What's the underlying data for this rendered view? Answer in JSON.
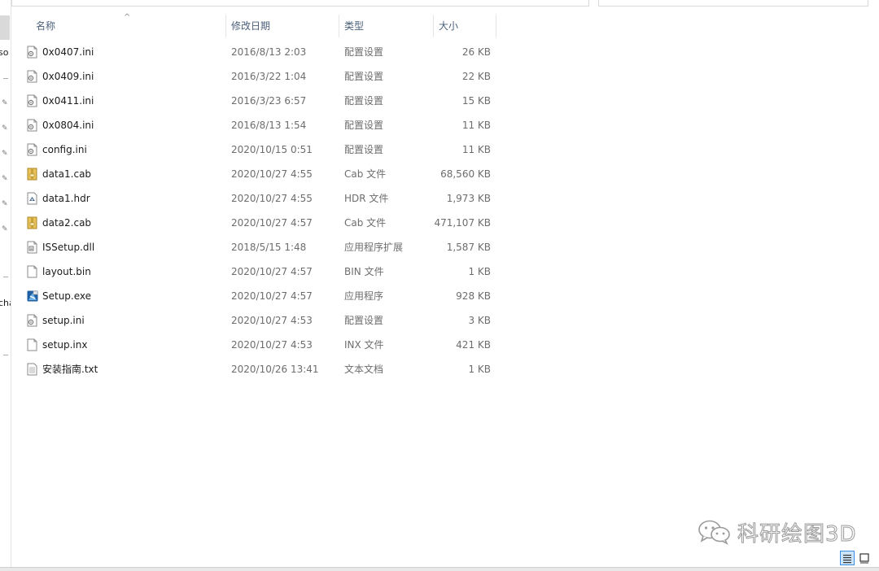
{
  "nav": {
    "fragments": [
      "so",
      "cha"
    ]
  },
  "columns": {
    "name": "名称",
    "date": "修改日期",
    "type": "类型",
    "size": "大小"
  },
  "files": [
    {
      "name": "0x0407.ini",
      "date": "2016/8/13 2:03",
      "type": "配置设置",
      "size": "26 KB",
      "icon": "ini-file-icon"
    },
    {
      "name": "0x0409.ini",
      "date": "2016/3/22 1:04",
      "type": "配置设置",
      "size": "22 KB",
      "icon": "ini-file-icon"
    },
    {
      "name": "0x0411.ini",
      "date": "2016/3/23 6:57",
      "type": "配置设置",
      "size": "15 KB",
      "icon": "ini-file-icon"
    },
    {
      "name": "0x0804.ini",
      "date": "2016/8/13 1:54",
      "type": "配置设置",
      "size": "11 KB",
      "icon": "ini-file-icon"
    },
    {
      "name": "config.ini",
      "date": "2020/10/15 0:51",
      "type": "配置设置",
      "size": "11 KB",
      "icon": "ini-file-icon"
    },
    {
      "name": "data1.cab",
      "date": "2020/10/27 4:55",
      "type": "Cab 文件",
      "size": "68,560 KB",
      "icon": "cab-file-icon"
    },
    {
      "name": "data1.hdr",
      "date": "2020/10/27 4:55",
      "type": "HDR 文件",
      "size": "1,973 KB",
      "icon": "hdr-file-icon"
    },
    {
      "name": "data2.cab",
      "date": "2020/10/27 4:57",
      "type": "Cab 文件",
      "size": "471,107 KB",
      "icon": "cab-file-icon"
    },
    {
      "name": "ISSetup.dll",
      "date": "2018/5/15 1:48",
      "type": "应用程序扩展",
      "size": "1,587 KB",
      "icon": "dll-file-icon"
    },
    {
      "name": "layout.bin",
      "date": "2020/10/27 4:57",
      "type": "BIN 文件",
      "size": "1 KB",
      "icon": "blank-file-icon"
    },
    {
      "name": "Setup.exe",
      "date": "2020/10/27 4:57",
      "type": "应用程序",
      "size": "928 KB",
      "icon": "setup-exe-icon"
    },
    {
      "name": "setup.ini",
      "date": "2020/10/27 4:53",
      "type": "配置设置",
      "size": "3 KB",
      "icon": "ini-file-icon"
    },
    {
      "name": "setup.inx",
      "date": "2020/10/27 4:53",
      "type": "INX 文件",
      "size": "421 KB",
      "icon": "blank-file-icon"
    },
    {
      "name": "安装指南.txt",
      "date": "2020/10/26 13:41",
      "type": "文本文档",
      "size": "1 KB",
      "icon": "txt-file-icon"
    }
  ],
  "watermark": {
    "text": "科研绘图3D",
    "icon": "wechat-icon"
  },
  "colors": {
    "header_text": "#4c607a",
    "selected_view": "#cce4f7",
    "selected_view_border": "#3a8ee6"
  }
}
